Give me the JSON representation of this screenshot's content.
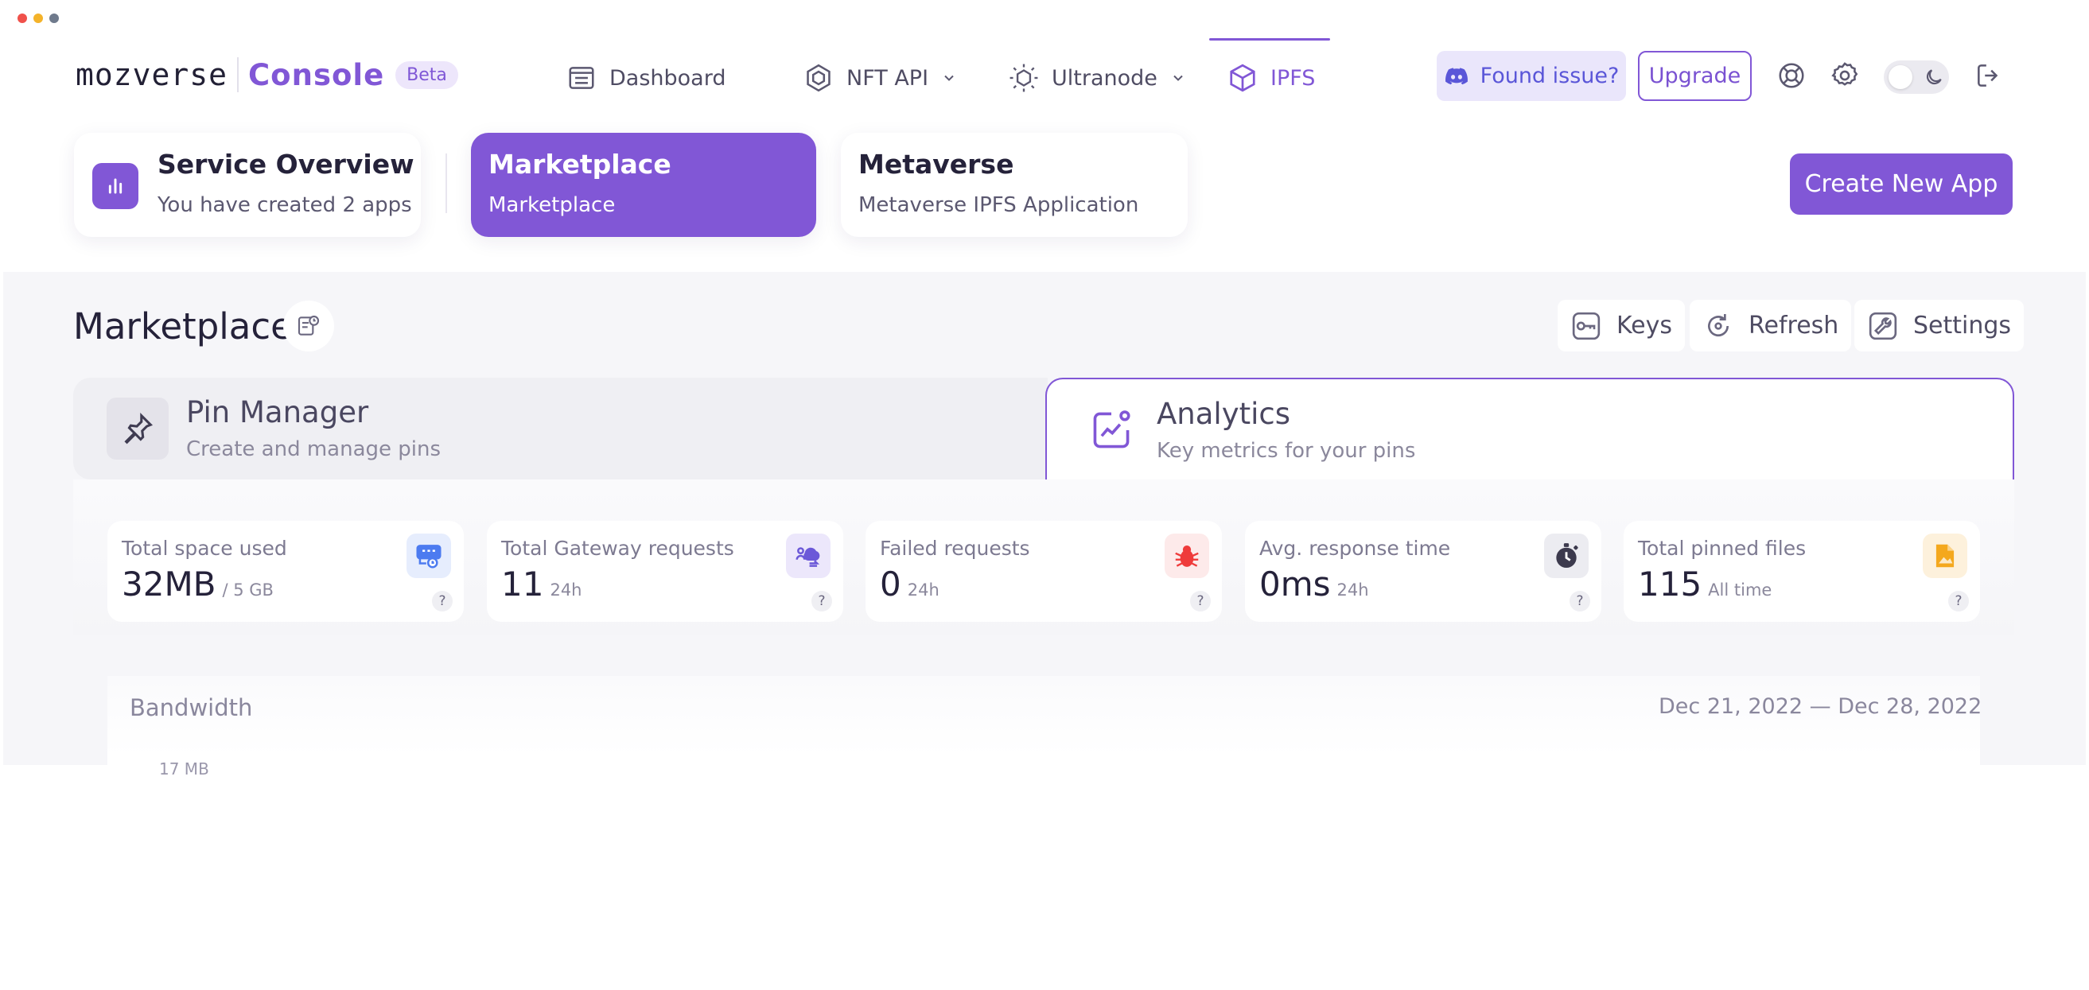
{
  "header": {
    "logo_word": "mozverse",
    "logo_console": "Console",
    "badge": "Beta",
    "nav": [
      {
        "label": "Dashboard"
      },
      {
        "label": "NFT API"
      },
      {
        "label": "Ultranode"
      },
      {
        "label": "IPFS"
      }
    ],
    "found_issue": "Found issue?",
    "upgrade": "Upgrade"
  },
  "apps": {
    "overview_title": "Service Overview",
    "overview_sub": "You have created 2 apps",
    "items": [
      {
        "title": "Marketplace",
        "sub": "Marketplace"
      },
      {
        "title": "Metaverse",
        "sub": "Metaverse IPFS Application"
      }
    ],
    "create_label": "Create New App"
  },
  "page": {
    "title": "Marketplace",
    "tools": [
      {
        "label": "Keys"
      },
      {
        "label": "Refresh"
      },
      {
        "label": "Settings"
      }
    ]
  },
  "tabs": [
    {
      "title": "Pin Manager",
      "sub": "Create and manage pins"
    },
    {
      "title": "Analytics",
      "sub": "Key metrics for your pins"
    }
  ],
  "stats": [
    {
      "label": "Total space used",
      "value": "32MB",
      "unit": "/ 5 GB",
      "icon": "storage-icon"
    },
    {
      "label": "Total Gateway requests",
      "value": "11",
      "unit": "24h",
      "icon": "cloud-transfer-icon"
    },
    {
      "label": "Failed requests",
      "value": "0",
      "unit": "24h",
      "icon": "bug-icon"
    },
    {
      "label": "Avg. response time",
      "value": "0ms",
      "unit": "24h",
      "icon": "stopwatch-icon"
    },
    {
      "label": "Total pinned files",
      "value": "115",
      "unit": "All time",
      "icon": "file-icon"
    }
  ],
  "help_glyph": "?",
  "bandwidth": {
    "title": "Bandwidth",
    "range": "Dec 21, 2022 — Dec 28, 2022",
    "tick": "17 MB"
  },
  "colors": {
    "accent": "#8157d6",
    "discord": "#5a56d8",
    "bug": "#ef3b3b",
    "file": "#f4a81d",
    "storage": "#4c7bf0"
  }
}
